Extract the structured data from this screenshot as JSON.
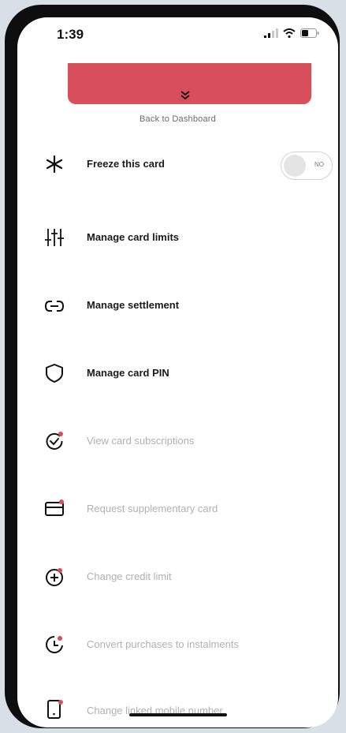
{
  "status_bar": {
    "time": "1:39"
  },
  "banner": {
    "back_label": "Back to Dashboard"
  },
  "freeze": {
    "label": "Freeze this card",
    "toggle_text": "NO",
    "enabled": false
  },
  "menu": {
    "items": [
      {
        "label": "Manage card limits",
        "icon": "sliders-icon",
        "enabled": true
      },
      {
        "label": "Manage settlement",
        "icon": "link-icon",
        "enabled": true
      },
      {
        "label": "Manage card PIN",
        "icon": "shield-icon",
        "enabled": true
      },
      {
        "label": "View card subscriptions",
        "icon": "subscription-check-icon",
        "enabled": false
      },
      {
        "label": "Request supplementary card",
        "icon": "credit-card-icon",
        "enabled": false
      },
      {
        "label": "Change credit limit",
        "icon": "plus-circle-icon",
        "enabled": false
      },
      {
        "label": "Convert purchases to instalments",
        "icon": "instalments-icon",
        "enabled": false
      },
      {
        "label": "Change linked mobile number",
        "icon": "mobile-icon",
        "enabled": false
      }
    ]
  },
  "colors": {
    "accent": "#d84e5b",
    "dim_text": "#b1b1b1",
    "notification_dot": "#d84e5b"
  }
}
